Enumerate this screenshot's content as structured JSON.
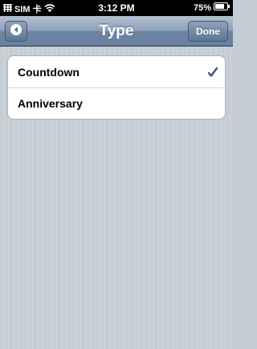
{
  "status_bar": {
    "carrier": "SIM 卡",
    "time": "3:12 PM",
    "battery": "75%"
  },
  "navbar": {
    "title": "Type",
    "done_label": "Done"
  },
  "type_options": [
    {
      "label": "Countdown",
      "selected": true
    },
    {
      "label": "Anniversary",
      "selected": false
    }
  ],
  "colors": {
    "nav_accent": "#6d84a2",
    "checkmark": "#385487",
    "background": "#c5ccd4"
  }
}
